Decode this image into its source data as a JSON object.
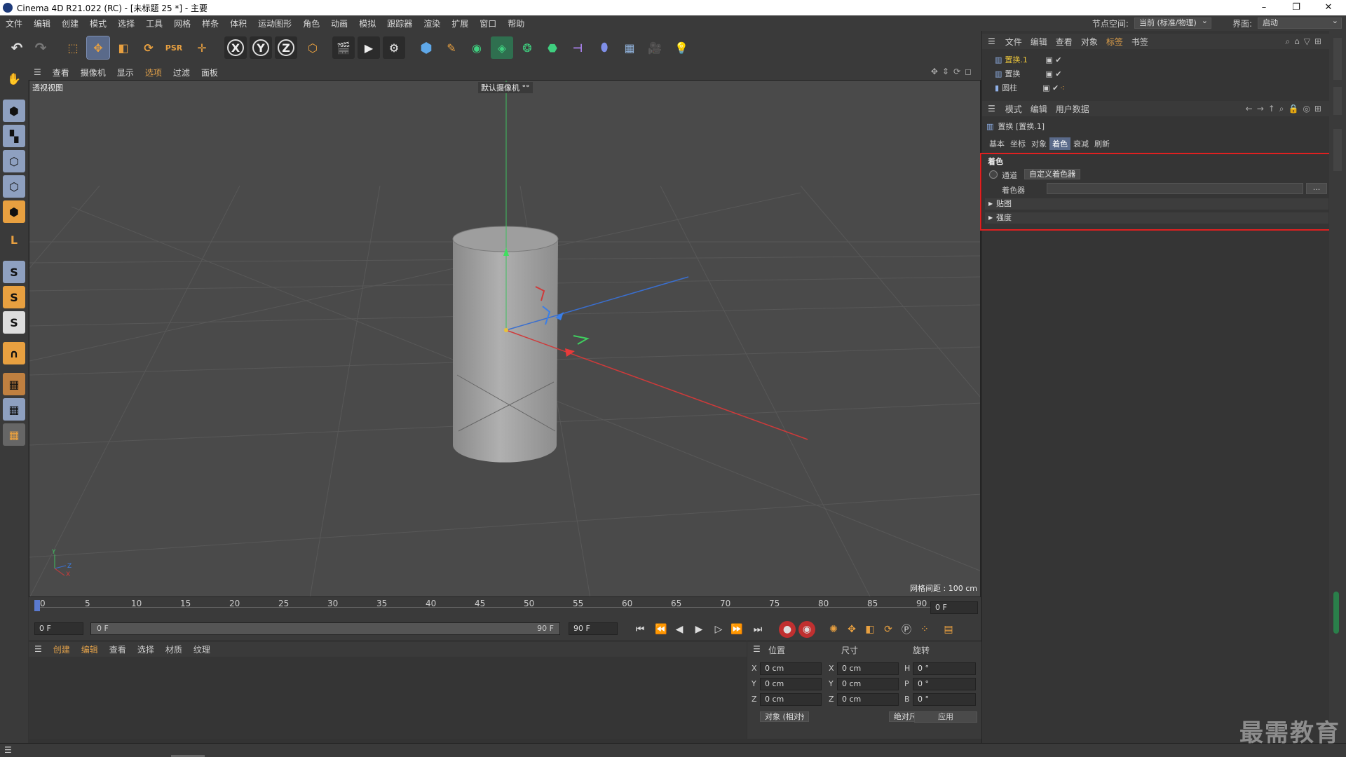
{
  "window": {
    "title": "Cinema 4D R21.022 (RC) - [未标题 25 *] - 主要",
    "minimize": "–",
    "restore": "❐",
    "close": "✕"
  },
  "menu": [
    "文件",
    "编辑",
    "创建",
    "模式",
    "选择",
    "工具",
    "网格",
    "样条",
    "体积",
    "运动图形",
    "角色",
    "动画",
    "模拟",
    "跟踪器",
    "渲染",
    "扩展",
    "窗口",
    "帮助"
  ],
  "menu_right": {
    "node_space_label": "节点空间:",
    "node_space_value": "当前 (标准/物理)",
    "layout_label": "界面:",
    "layout_value": "启动"
  },
  "viewport": {
    "menu": [
      "查看",
      "摄像机",
      "显示",
      "选项",
      "过滤",
      "面板"
    ],
    "name": "透视视图",
    "camera": "默认摄像机 °°",
    "grid_info": "网格间距 : 100 cm",
    "axis_labels": {
      "y": "Y",
      "z": "Z",
      "x": "X"
    }
  },
  "timeline": {
    "ticks": [
      "0",
      "5",
      "10",
      "15",
      "20",
      "25",
      "30",
      "35",
      "40",
      "45",
      "50",
      "55",
      "60",
      "65",
      "70",
      "75",
      "80",
      "85",
      "90"
    ],
    "current_frame": "0 F"
  },
  "transport": {
    "start": "0 F",
    "range_start": "0 F",
    "range_end": "90 F",
    "end": "90 F"
  },
  "material_panel": {
    "menu": [
      "创建",
      "编辑",
      "查看",
      "选择",
      "材质",
      "纹理"
    ]
  },
  "coordinates": {
    "headers": [
      "位置",
      "尺寸",
      "旋转"
    ],
    "rows": [
      {
        "axis": "X",
        "pos": "0 cm",
        "size_axis": "X",
        "size": "0 cm",
        "rot_axis": "H",
        "rot": "0 °"
      },
      {
        "axis": "Y",
        "pos": "0 cm",
        "size_axis": "Y",
        "size": "0 cm",
        "rot_axis": "P",
        "rot": "0 °"
      },
      {
        "axis": "Z",
        "pos": "0 cm",
        "size_axis": "Z",
        "size": "0 cm",
        "rot_axis": "B",
        "rot": "0 °"
      }
    ],
    "mode": "对象 (相对)",
    "size_mode": "绝对尺寸",
    "apply": "应用"
  },
  "object_manager": {
    "menu": [
      "文件",
      "编辑",
      "查看",
      "对象",
      "标签",
      "书签"
    ],
    "objects": [
      {
        "name": "置换.1",
        "active": true
      },
      {
        "name": "置换",
        "active": false
      },
      {
        "name": "圆柱",
        "active": false
      }
    ]
  },
  "attributes": {
    "menu": [
      "模式",
      "编辑",
      "用户数据"
    ],
    "object_title": "置换 [置换.1]",
    "tabs": [
      "基本",
      "坐标",
      "对象",
      "着色",
      "衰减",
      "刷新"
    ],
    "active_tab": "着色",
    "section": "着色",
    "channel_label": "通道",
    "channel_value": "自定义着色器",
    "shader_label": "着色器",
    "shader_more": "...",
    "groups": [
      "贴图",
      "强度"
    ]
  },
  "watermark": "最需教育",
  "colors": {
    "accent": "#5a6a8a",
    "highlight": "#e02020",
    "object_active": "#e8c23a"
  }
}
